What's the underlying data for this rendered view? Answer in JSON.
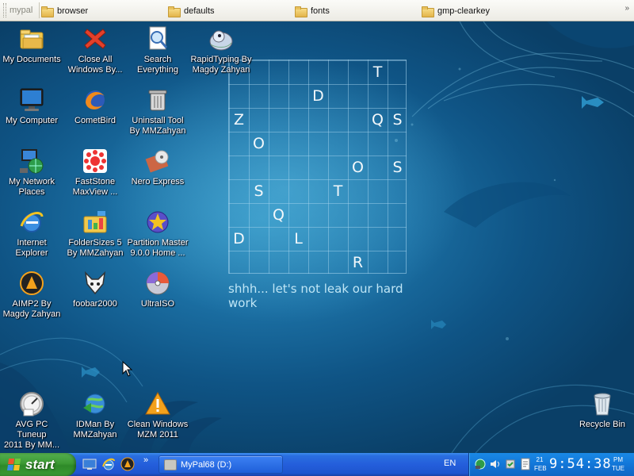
{
  "folder_bar": {
    "title": "mypal",
    "folders": [
      "browser",
      "defaults",
      "fonts",
      "gmp-clearkey"
    ]
  },
  "desktop": {
    "icons": [
      {
        "id": "my-documents",
        "label": "My Documents"
      },
      {
        "id": "close-all",
        "label": "Close All\nWindows By..."
      },
      {
        "id": "search-everything",
        "label": "Search\nEverything"
      },
      {
        "id": "rapidtyping",
        "label": "RapidTyping By\nMagdy Zahyan"
      },
      {
        "id": "my-computer",
        "label": "My Computer"
      },
      {
        "id": "cometbird",
        "label": "CometBird"
      },
      {
        "id": "uninstall-tool",
        "label": "Uninstall Tool\nBy MMZahyan"
      },
      {
        "id": "my-network-places",
        "label": "My Network\nPlaces"
      },
      {
        "id": "faststone",
        "label": "FastStone\nMaxView ..."
      },
      {
        "id": "nero-express",
        "label": "Nero Express"
      },
      {
        "id": "internet-explorer",
        "label": "Internet\nExplorer"
      },
      {
        "id": "foldersizes",
        "label": "FolderSizes 5\nBy MMZahyan"
      },
      {
        "id": "partition-master",
        "label": "Partition Master\n9.0.0 Home ..."
      },
      {
        "id": "aimp2",
        "label": "AIMP2  By\nMagdy Zahyan"
      },
      {
        "id": "foobar2000",
        "label": "foobar2000"
      },
      {
        "id": "ultraiso",
        "label": "UltraISO"
      },
      {
        "id": "avg-pc-tuneup",
        "label": "AVG PC Tuneup\n2011 By MM..."
      },
      {
        "id": "idman",
        "label": "IDMan By\nMMZahyan"
      },
      {
        "id": "clean-windows",
        "label": "Clean Windows\nMZM 2011"
      },
      {
        "id": "recycle-bin",
        "label": "Recycle Bin"
      }
    ]
  },
  "wallpaper": {
    "letters": [
      {
        "ch": "T",
        "col": 7,
        "row": 0
      },
      {
        "ch": "D",
        "col": 4,
        "row": 1
      },
      {
        "ch": "Z",
        "col": 0,
        "row": 2
      },
      {
        "ch": "Q",
        "col": 7,
        "row": 2
      },
      {
        "ch": "S",
        "col": 8,
        "row": 2
      },
      {
        "ch": "O",
        "col": 1,
        "row": 3
      },
      {
        "ch": "O",
        "col": 6,
        "row": 4
      },
      {
        "ch": "S",
        "col": 8,
        "row": 4
      },
      {
        "ch": "S",
        "col": 1,
        "row": 5
      },
      {
        "ch": "T",
        "col": 5,
        "row": 5
      },
      {
        "ch": "Q",
        "col": 2,
        "row": 6
      },
      {
        "ch": "D",
        "col": 0,
        "row": 7
      },
      {
        "ch": "L",
        "col": 3,
        "row": 7
      },
      {
        "ch": "R",
        "col": 6,
        "row": 8
      }
    ],
    "tagline": "shhh... let's not leak our hard work"
  },
  "taskbar": {
    "start_label": "start",
    "task_button_label": "MyPal68 (D:)",
    "language": "EN",
    "date_day": "21",
    "date_month": "FEB",
    "time": "9:54:38",
    "ampm": "PM",
    "weekday": "TUE"
  },
  "colors": {
    "wallpaper_blue": "#1b6fa3",
    "taskbar_blue": "#245edb",
    "start_green": "#3c9a34",
    "tray_blue": "#1276d8"
  }
}
